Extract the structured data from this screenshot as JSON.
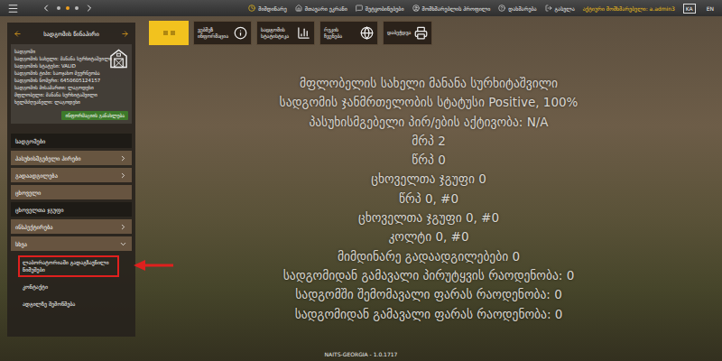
{
  "window": {
    "footer": "NAITS-GEORGIA - 1.0.1717"
  },
  "topbar": {
    "menu": [
      {
        "label": "მიმდინარე"
      },
      {
        "label": "მთავარი ეკრანი"
      },
      {
        "label": "შეტყობინებები"
      },
      {
        "label": "მომხმარებლის პროფილი"
      },
      {
        "label": "დახმარება"
      },
      {
        "label": "გასვლა"
      }
    ],
    "user": "აქტიური მომხმარებელი: a.admin3",
    "languages": [
      {
        "label": "KA",
        "selected": true
      },
      {
        "label": "EN",
        "selected": false
      }
    ]
  },
  "sidebar": {
    "title": "სადგომის წინაპირი",
    "info": [
      "სადგომი",
      "სადგომის სახელი: მანანა სურხიტაშვილი",
      "სადგომის სტატუსი: VALID",
      "სადგომის ტიპი: საოჯახო მეურნეობა",
      "სადგომის ნომერი: 6450605124157",
      "სადგომის მისამართი: ლაგოდეხი",
      "მფლობელი: მანანა სურხიტაშვილი",
      "ხელმძღვანელი: ლაგოდეხი"
    ],
    "refresh_button": "ინფორმაციის განახლება",
    "menu": [
      {
        "label": "სადგომები",
        "kind": "header",
        "has_children": false,
        "expanded": false,
        "children": []
      },
      {
        "label": "პასუხისმგებელი პირები",
        "kind": "item",
        "has_children": true,
        "expanded": false,
        "children": []
      },
      {
        "label": "გადაადგილება",
        "kind": "item",
        "has_children": true,
        "expanded": false,
        "children": []
      },
      {
        "label": "ცხოველი",
        "kind": "item",
        "has_children": false,
        "expanded": false,
        "children": []
      },
      {
        "label": "ცხოველთა ჯგუფი",
        "kind": "header",
        "has_children": false,
        "expanded": false,
        "children": []
      },
      {
        "label": "ინსპექტირება",
        "kind": "item",
        "has_children": true,
        "expanded": false,
        "children": []
      },
      {
        "label": "სხვა",
        "kind": "item",
        "has_children": true,
        "expanded": true,
        "children": [
          {
            "label": "ლაბორატორიაში გადაგზავნილი ნიმუშები",
            "highlighted": true
          },
          {
            "label": "კონტაქტი",
            "highlighted": false
          },
          {
            "label": "ადგილზე შემოწმება",
            "highlighted": false
          }
        ]
      }
    ]
  },
  "toolbar": {
    "view_toggle": {
      "selected": true
    },
    "buttons": [
      {
        "label": "ვებშეზ ინფორმაცია",
        "selected": false
      },
      {
        "label": "სადგომის სტატისტიკა",
        "selected": false
      },
      {
        "label": "რუკის ჩვენება",
        "selected": false
      },
      {
        "label": "დაბეჭდვა",
        "selected": false
      }
    ]
  },
  "summary": [
    "მფლობელის სახელი მანანა სურხიტაშვილი",
    "სადგომის ჯანმრთელობის სტატუსი Positive, 100%",
    "პასუხისმგებელი პირ/ების აქტივობა: N/A",
    "მრპ 2",
    "წრპ 0",
    "ცხოველთა ჯგუფი 0",
    "წრპ 0, #0",
    "ცხოველთა ჯგუფი 0, #0",
    "კოლტი 0, #0",
    "მიმდინარე გადაადგილებები 0",
    "სადგომიდან გამავალი პირუტყვის რაოდენობა: 0",
    "სადგომში შემომავალი ფარას რაოდენობა: 0",
    "სადგომიდან გამავალი ფარას რაოდენობა: 0"
  ]
}
